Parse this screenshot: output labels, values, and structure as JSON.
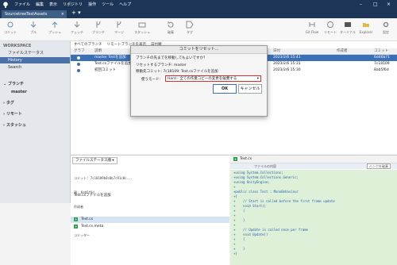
{
  "app": {
    "title": "SourcetreeTestAssets"
  },
  "titlebar": {
    "menu": [
      "ファイル",
      "編集",
      "表示",
      "リポジトリ",
      "操作",
      "ツール",
      "ヘルプ"
    ]
  },
  "toolbar": {
    "left": [
      "コミット",
      "プル",
      "プッシュ",
      "フェッチ",
      "ブランチ",
      "マージ",
      "スタッシュ",
      "破棄",
      "タグ"
    ],
    "right": [
      "Git Flow",
      "リモート",
      "ターミナル",
      "Explorer",
      "設定"
    ]
  },
  "sidebar": {
    "workspace": "WORKSPACE",
    "file_status": "ファイルステータス",
    "history": "History",
    "search": "Search",
    "branches": "ブランチ",
    "branch_master": "master",
    "tags": "タグ",
    "remotes": "リモート",
    "stash": "スタッシュ"
  },
  "list": {
    "filters": [
      "すべてのブランチ",
      "リモートブランチを表示",
      "日付順"
    ],
    "headers": [
      "グラフ",
      "説明",
      "日付",
      "作成者",
      "コミット"
    ],
    "rows": [
      {
        "desc": "master  Testを追加",
        "date": "2023/2/6 15:41",
        "hash": "6d46b71",
        "sel": true
      },
      {
        "desc": "Test.csファイルを追加",
        "date": "2023/2/6 15:31",
        "hash": "7c18109",
        "sel": false
      },
      {
        "desc": "初回コミット",
        "date": "2023/2/6 15:30",
        "hash": "8ab5f6d",
        "sel": false
      }
    ]
  },
  "dialog": {
    "title": "コミットをリセット...",
    "question": "ブランチの先までを移動してもよいですか？",
    "reset_branch": "リセットするブランチ: master",
    "move_to": "移動先コミット: 7c18109: Test.csファイルを追加",
    "mode_label": "使うモード:",
    "mode_value": "Hard - 全ての作業コピーの変更を破棄する",
    "ok": "OK",
    "cancel": "キャンセル"
  },
  "details": {
    "header": "ファイルステータス順",
    "commit_info": "コミット: 7c18109b8c0b7c91c8c...",
    "parent": "親: 8ab5f6d",
    "author": "作成者",
    "date": "日付: 2023年2月6日 15:31:51",
    "committer": "コミッター",
    "message": "Test.csファイルを追加",
    "files": [
      "Test.cs",
      "Test.cs.meta"
    ]
  },
  "diff": {
    "file": "Test.cs",
    "hunk": "ファイルの内容",
    "actions": "ハンクを破棄",
    "lines": [
      "+using System.Collections;",
      "+using System.Collections.Generic;",
      "+using UnityEngine;",
      "+",
      "+public class Test : MonoBehaviour",
      "+{",
      "+    // Start is called before the first frame update",
      "+    void Start()",
      "+    {",
      "+",
      "+    }",
      "+",
      "+    // Update is called once per frame",
      "+    void Update()",
      "+    {",
      "+",
      "+    }",
      "+}"
    ]
  }
}
